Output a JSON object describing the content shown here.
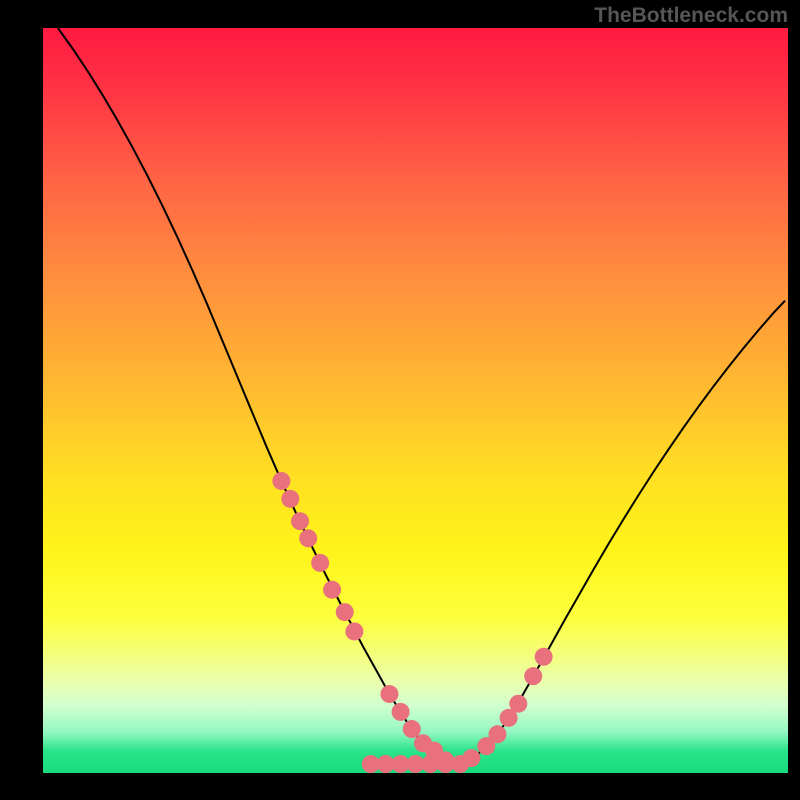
{
  "watermark": "TheBottleneck.com",
  "colors": {
    "gradient_stops": [
      {
        "offset": 0.0,
        "color": "#ff1a41"
      },
      {
        "offset": 0.07,
        "color": "#ff2f44"
      },
      {
        "offset": 0.2,
        "color": "#ff6245"
      },
      {
        "offset": 0.33,
        "color": "#ff8d3f"
      },
      {
        "offset": 0.47,
        "color": "#ffb632"
      },
      {
        "offset": 0.6,
        "color": "#ffdf22"
      },
      {
        "offset": 0.7,
        "color": "#fff41a"
      },
      {
        "offset": 0.79,
        "color": "#fdff3d"
      },
      {
        "offset": 0.84,
        "color": "#f4ff7a"
      },
      {
        "offset": 0.88,
        "color": "#e8ffb0"
      },
      {
        "offset": 0.91,
        "color": "#d1ffce"
      },
      {
        "offset": 0.945,
        "color": "#93f8c2"
      },
      {
        "offset": 0.97,
        "color": "#2be48a"
      },
      {
        "offset": 1.0,
        "color": "#18db7e"
      }
    ],
    "curve": "#000000",
    "marker_fill": "#e9717d",
    "marker_stroke": "#c94f5d",
    "background": "#000000"
  },
  "chart_data": {
    "type": "line",
    "title": "",
    "xlabel": "",
    "ylabel": "",
    "xlim": [
      0,
      100
    ],
    "ylim": [
      0,
      100
    ],
    "curve": {
      "x": [
        2,
        4,
        6,
        8,
        10,
        12,
        14,
        16,
        18,
        20,
        22,
        24,
        26,
        28,
        30,
        32,
        34,
        36,
        38,
        40,
        42,
        43,
        44,
        45,
        46,
        47,
        48,
        49,
        50,
        51,
        52,
        53,
        54,
        55,
        56,
        57,
        58,
        60,
        62,
        64,
        66,
        68,
        70,
        72,
        74,
        76,
        78,
        80,
        82,
        84,
        86,
        88,
        90,
        92,
        94,
        96,
        98,
        99.6
      ],
      "y": [
        100,
        97.2,
        94.2,
        91.0,
        87.6,
        84.0,
        80.2,
        76.2,
        72.0,
        67.6,
        63.0,
        58.2,
        53.4,
        48.6,
        43.8,
        39.2,
        34.8,
        30.6,
        26.5,
        22.6,
        18.8,
        16.9,
        15.1,
        13.3,
        11.5,
        9.8,
        8.2,
        6.6,
        5.2,
        4.0,
        3.0,
        2.2,
        1.7,
        1.4,
        1.4,
        1.7,
        2.2,
        4.0,
        6.6,
        9.8,
        13.3,
        16.9,
        20.5,
        24.0,
        27.5,
        30.9,
        34.2,
        37.4,
        40.5,
        43.5,
        46.4,
        49.2,
        51.9,
        54.5,
        57.0,
        59.4,
        61.7,
        63.4
      ]
    },
    "markers": {
      "x": [
        32.0,
        33.2,
        34.5,
        35.6,
        37.2,
        38.8,
        40.5,
        41.8,
        46.5,
        48.0,
        49.5,
        51.0,
        52.5,
        54.0,
        57.5,
        59.5,
        61.0,
        62.5,
        63.8,
        65.8,
        67.2
      ],
      "y": [
        39.2,
        36.8,
        33.8,
        31.5,
        28.2,
        24.6,
        21.6,
        19.0,
        10.6,
        8.2,
        5.9,
        4.0,
        3.0,
        1.7,
        2.0,
        3.6,
        5.2,
        7.4,
        9.3,
        13.0,
        15.6
      ]
    },
    "bottom_dots": {
      "x": [
        44,
        46,
        48,
        50,
        52,
        54,
        56
      ],
      "y": [
        1.2,
        1.2,
        1.2,
        1.2,
        1.2,
        1.2,
        1.2
      ]
    }
  }
}
